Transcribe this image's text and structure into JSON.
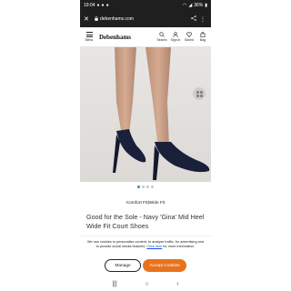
{
  "status_bar": {
    "time": "19:04",
    "battery": "36%"
  },
  "browser": {
    "url": "debenhams.com"
  },
  "site_nav": {
    "menu_label": "Menu",
    "logo": "Debenhams",
    "icons": [
      {
        "label": "Search",
        "icon": "search-icon"
      },
      {
        "label": "Sign in",
        "icon": "user-icon"
      },
      {
        "label": "Saved",
        "icon": "heart-icon"
      },
      {
        "label": "Bag",
        "icon": "bag-icon"
      }
    ]
  },
  "product": {
    "fit": "Comfort Fit|Wide Fit",
    "title": "Good for the Sole - Navy 'Gina' Mid Heel Wide Fit Court Shoes",
    "image_count": 4,
    "active_image": 1
  },
  "cookie_banner": {
    "text": "We use cookies to personalise content, to analyse traffic, for advertising and to provide social media features.",
    "link_text": "Click here",
    "text_after": "for more information.",
    "manage_label": "Manage",
    "accept_label": "Accept Cookies"
  },
  "system_nav": {
    "recents": "|||",
    "home": "○",
    "back": "‹"
  },
  "colors": {
    "accent": "#e8721c",
    "status_bar": "#1f1f1f",
    "active_dot": "#2d8fc9",
    "shoe": "#1a1f3a"
  }
}
